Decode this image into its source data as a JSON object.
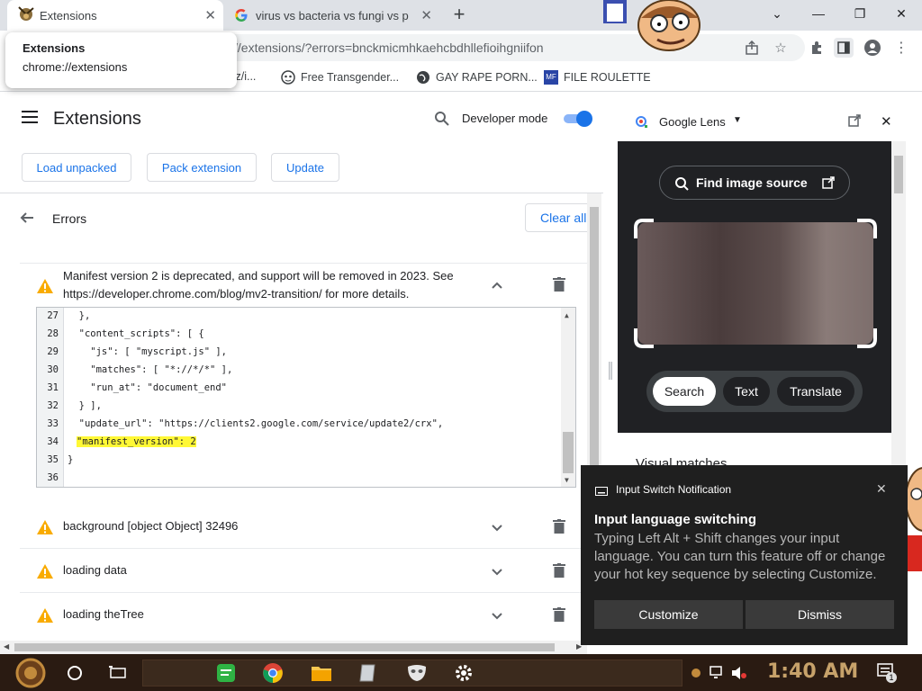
{
  "tabs": [
    {
      "title": "Extensions",
      "close": "✕"
    },
    {
      "title": "virus vs bacteria vs fungi vs pr",
      "close": "✕"
    }
  ],
  "new_tab": "+",
  "window_controls": {
    "minimize_icon": "chevron-down-icon",
    "chev": "⌄",
    "min": "—",
    "restore": "❐",
    "close": "✕"
  },
  "tooltip": {
    "title": "Extensions",
    "url": "chrome://extensions"
  },
  "omnibox": {
    "text": "//extensions/?errors=bnckmicmhkaehcbdhllefioihgniifon"
  },
  "bookmarks": [
    {
      "label": "tz/i..."
    },
    {
      "label": "Free Transgender..."
    },
    {
      "label": "GAY RAPE PORN..."
    },
    {
      "label": "FILE ROULETTE"
    }
  ],
  "page": {
    "title": "Extensions",
    "developer_mode_label": "Developer mode",
    "developer_mode_on": true,
    "buttons": {
      "load_unpacked": "Load unpacked",
      "pack_extension": "Pack extension",
      "update": "Update"
    },
    "errors_title": "Errors",
    "clear_all": "Clear all"
  },
  "errors": [
    {
      "message": "Manifest version 2 is deprecated, and support will be removed in 2023. See https://developer.chrome.com/blog/mv2-transition/ for more details.",
      "expanded": true
    },
    {
      "message": "background [object Object] 32496",
      "expanded": false
    },
    {
      "message": "loading data",
      "expanded": false
    },
    {
      "message": "loading theTree",
      "expanded": false
    }
  ],
  "code": {
    "lines": [
      {
        "n": "27",
        "text": "  },",
        "highlight": false
      },
      {
        "n": "28",
        "text": "  \"content_scripts\": [ {",
        "highlight": false
      },
      {
        "n": "29",
        "text": "    \"js\": [ \"myscript.js\" ],",
        "highlight": false
      },
      {
        "n": "30",
        "text": "    \"matches\": [ \"*://*/*\" ],",
        "highlight": false
      },
      {
        "n": "31",
        "text": "    \"run_at\": \"document_end\"",
        "highlight": false
      },
      {
        "n": "32",
        "text": "  } ],",
        "highlight": false
      },
      {
        "n": "33",
        "text": "  \"update_url\": \"https://clients2.google.com/service/update2/crx\",",
        "highlight": false
      },
      {
        "n": "34",
        "text": "\"manifest_version\": 2",
        "highlight": true
      },
      {
        "n": "35",
        "text": "}",
        "highlight": false
      },
      {
        "n": "36",
        "text": "",
        "highlight": false
      }
    ]
  },
  "lens": {
    "title": "Google Lens",
    "find_source": "Find image source",
    "chips": [
      "Search",
      "Text",
      "Translate"
    ],
    "visual_matches": "Visual matches"
  },
  "notification": {
    "app": "Input Switch Notification",
    "title": "Input language switching",
    "body": "Typing Left Alt + Shift changes your input language. You can turn this feature off or change your hot key sequence by selecting Customize.",
    "customize": "Customize",
    "dismiss": "Dismiss"
  },
  "taskbar": {
    "time": "1:40 AM",
    "notif_count": "1"
  },
  "colors": {
    "accent": "#1a73e8",
    "warning": "#f9ab00",
    "highlight": "#fff835",
    "taskbar": "#2a1b12"
  }
}
